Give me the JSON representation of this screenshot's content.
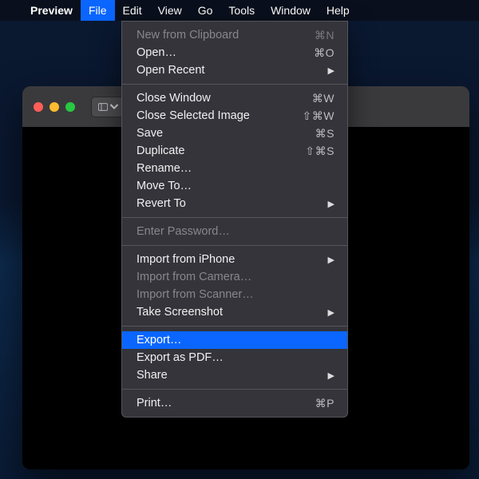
{
  "menubar": {
    "app": "Preview",
    "items": [
      "File",
      "Edit",
      "View",
      "Go",
      "Tools",
      "Window",
      "Help"
    ],
    "active_index": 0
  },
  "file_menu": {
    "groups": [
      [
        {
          "label": "New from Clipboard",
          "shortcut": "⌘N",
          "enabled": false
        },
        {
          "label": "Open…",
          "shortcut": "⌘O",
          "enabled": true
        },
        {
          "label": "Open Recent",
          "submenu": true,
          "enabled": true
        }
      ],
      [
        {
          "label": "Close Window",
          "shortcut": "⌘W",
          "enabled": true
        },
        {
          "label": "Close Selected Image",
          "shortcut": "⇧⌘W",
          "enabled": true
        },
        {
          "label": "Save",
          "shortcut": "⌘S",
          "enabled": true
        },
        {
          "label": "Duplicate",
          "shortcut": "⇧⌘S",
          "enabled": true
        },
        {
          "label": "Rename…",
          "enabled": true
        },
        {
          "label": "Move To…",
          "enabled": true
        },
        {
          "label": "Revert To",
          "submenu": true,
          "enabled": true
        }
      ],
      [
        {
          "label": "Enter Password…",
          "enabled": false
        }
      ],
      [
        {
          "label": "Import from iPhone",
          "submenu": true,
          "enabled": true
        },
        {
          "label": "Import from Camera…",
          "enabled": false
        },
        {
          "label": "Import from Scanner…",
          "enabled": false
        },
        {
          "label": "Take Screenshot",
          "submenu": true,
          "enabled": true
        }
      ],
      [
        {
          "label": "Export…",
          "enabled": true,
          "highlight": true
        },
        {
          "label": "Export as PDF…",
          "enabled": true
        },
        {
          "label": "Share",
          "submenu": true,
          "enabled": true
        }
      ],
      [
        {
          "label": "Print…",
          "shortcut": "⌘P",
          "enabled": true
        }
      ]
    ]
  }
}
